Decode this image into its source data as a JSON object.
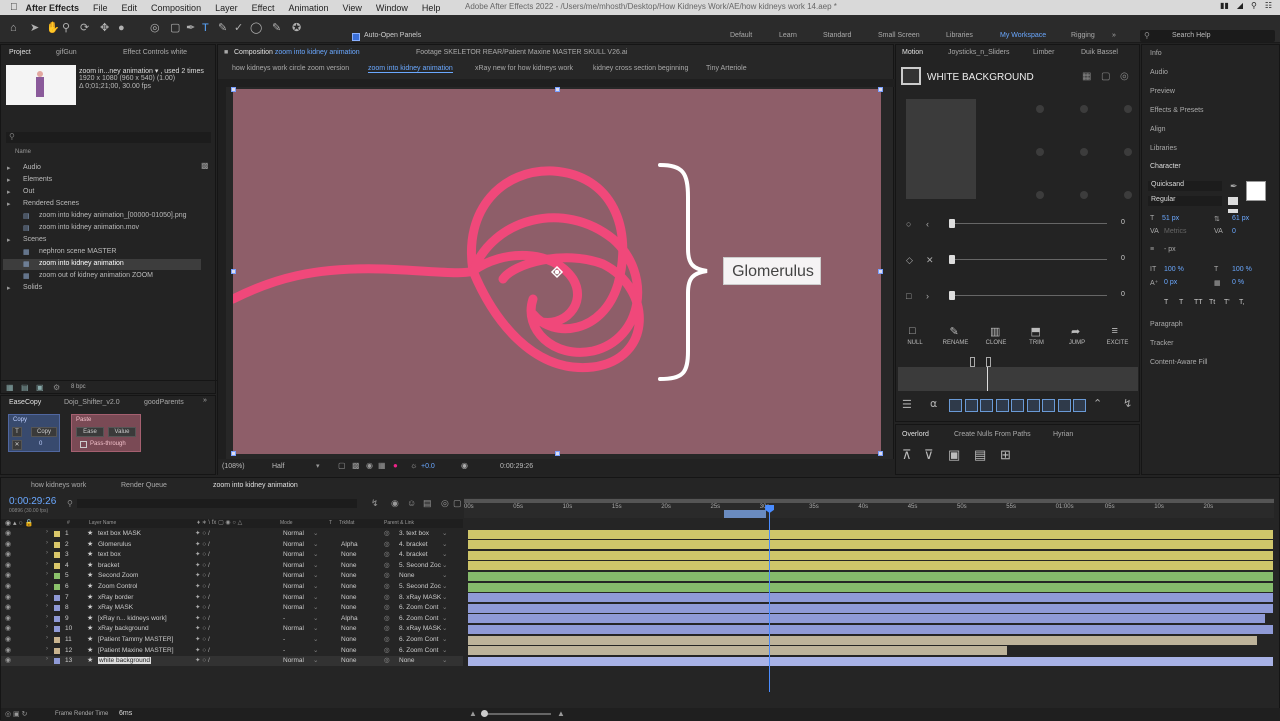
{
  "menubar": {
    "app": "After Effects",
    "items": [
      "File",
      "Edit",
      "Composition",
      "Layer",
      "Effect",
      "Animation",
      "View",
      "Window",
      "Help"
    ],
    "title": "Adobe After Effects 2022 - /Users/me/mhosth/Desktop/How Kidneys Work/AE/how kidneys work 14.aep *",
    "search": "Search Help"
  },
  "toolbar": {
    "auto_open": "Auto-Open Panels",
    "workspaces": [
      "Default",
      "Learn",
      "Standard",
      "Small Screen",
      "Libraries",
      "My Workspace",
      "Rigging"
    ],
    "active_ws": "My Workspace"
  },
  "project": {
    "tabs": [
      "Project",
      "gifGun",
      "Effect Controls white"
    ],
    "thumb_name": "zoom in...ney animation ▾ , used 2 times",
    "thumb_size": "1920 x 1080  (960 x 540) (1.00)",
    "thumb_dur": "Δ 0;01;21;00, 30.00 fps",
    "col_name": "Name",
    "tree": [
      {
        "label": "Audio",
        "indent": 0,
        "kind": "folder"
      },
      {
        "label": "Elements",
        "indent": 0,
        "kind": "folder"
      },
      {
        "label": "Out",
        "indent": 0,
        "kind": "folder"
      },
      {
        "label": "Rendered Scenes",
        "indent": 0,
        "kind": "folder"
      },
      {
        "label": "zoom into kidney animation_[00000-01050].png",
        "indent": 1,
        "kind": "file"
      },
      {
        "label": "zoom into kidney animation.mov",
        "indent": 1,
        "kind": "file"
      },
      {
        "label": "Scenes",
        "indent": 0,
        "kind": "folder"
      },
      {
        "label": "nephron scene MASTER",
        "indent": 1,
        "kind": "comp"
      },
      {
        "label": "zoom into kidney animation",
        "indent": 1,
        "kind": "comp"
      },
      {
        "label": "zoom out of kidney animation ZOOM",
        "indent": 1,
        "kind": "comp"
      },
      {
        "label": "Solids",
        "indent": 0,
        "kind": "folder"
      }
    ],
    "bpc": "8 bpc"
  },
  "easecopy": {
    "tabs": [
      "EaseCopy",
      "Dojo_Shifter_v2.0",
      "goodParents"
    ],
    "copy_title": "Copy",
    "copy_btn": "Copy",
    "copy_val": "0",
    "paste_title": "Paste",
    "ease_btn": "Ease",
    "value_btn": "Value",
    "passthrough": "Pass-through"
  },
  "viewer": {
    "tabs": [
      "Composition zoom into kidney animation",
      "Footage SKELETOR REAR/Patient Maxine MASTER SKULL V26.ai"
    ],
    "comp_prefix": "Composition",
    "comp_name": "zoom into kidney animation",
    "crumbs": [
      "how kidneys work circle zoom version",
      "zoom into kidney animation",
      "xRay new for how kidneys work",
      "kidney cross section beginning",
      "Tiny Arteriole"
    ],
    "label": "Glomerulus",
    "zoom": "(108%)",
    "res": "Half",
    "exposure": "+0.0",
    "timecode": "0:00:29:26",
    "canvas_color": "#8e5e69",
    "stroke_color": "#f0487a"
  },
  "motion": {
    "tabs": [
      "Motion",
      "Joysticks_n_Sliders",
      "Limber",
      "Duik Bassel"
    ],
    "layer": "WHITE BACKGROUND",
    "slider_vals": [
      "0",
      "0",
      "0"
    ],
    "buttons": [
      "NULL",
      "RENAME",
      "CLONE",
      "TRIM",
      "JUMP",
      "EXCITE"
    ]
  },
  "overlord": {
    "tabs": [
      "Overlord",
      "Create Nulls From Paths",
      "Hyrian"
    ]
  },
  "right": {
    "items": [
      "Info",
      "Audio",
      "Preview",
      "Effects & Presets",
      "Align",
      "Libraries"
    ],
    "character": "Character",
    "font": "Quicksand",
    "style": "Regular",
    "size": "51 px",
    "leading": "61 px",
    "tracking": "0",
    "kerning_label": "Metrics",
    "stroke": "- px",
    "vscale": "100 %",
    "hscale": "100 %",
    "baseline": "0 px",
    "tsume": "0 %",
    "styles": [
      "T",
      "T",
      "TT",
      "Tt",
      "T'",
      "T,"
    ],
    "bottom": [
      "Paragraph",
      "Tracker",
      "Content-Aware Fill"
    ]
  },
  "timeline": {
    "tabs": [
      "how kidneys work",
      "Render Queue",
      "zoom into kidney animation"
    ],
    "time": "0:00:29:26",
    "frames": "00896 (30.00 fps)",
    "cols": {
      "name": "Layer Name",
      "mode": "Mode",
      "t": "T",
      "trkmat": "TrkMat",
      "parent": "Parent & Link"
    },
    "ruler": [
      "00s",
      "05s",
      "10s",
      "15s",
      "20s",
      "25s",
      "30s",
      "35s",
      "40s",
      "45s",
      "50s",
      "55s",
      "01:00s",
      "05s",
      "10s",
      "20s"
    ],
    "layers": [
      {
        "num": "1",
        "name": "text box MASK",
        "color": "#d9c76a",
        "mode": "Normal",
        "trk": "",
        "parent": "3. text box",
        "bar": "#cfc66a",
        "start": 0,
        "end": 1
      },
      {
        "num": "2",
        "name": "Glomerulus",
        "color": "#d9c76a",
        "mode": "Normal",
        "trk": "Alpha",
        "parent": "4. bracket",
        "bar": "#cfc66a",
        "start": 0,
        "end": 1
      },
      {
        "num": "3",
        "name": "text box",
        "color": "#d9c76a",
        "mode": "Normal",
        "trk": "None",
        "parent": "4. bracket",
        "bar": "#cfc66a",
        "start": 0,
        "end": 1
      },
      {
        "num": "4",
        "name": "bracket",
        "color": "#d9c76a",
        "mode": "Normal",
        "trk": "None",
        "parent": "5. Second Zoc",
        "bar": "#cfc66a",
        "start": 0,
        "end": 1
      },
      {
        "num": "5",
        "name": "Second Zoom",
        "color": "#8bc26b",
        "mode": "Normal",
        "trk": "None",
        "parent": "None",
        "bar": "#86ba6c",
        "start": 0,
        "end": 1
      },
      {
        "num": "6",
        "name": "Zoom Control",
        "color": "#8bc26b",
        "mode": "Normal",
        "trk": "None",
        "parent": "5. Second Zoc",
        "bar": "#86ba6c",
        "start": 0,
        "end": 1
      },
      {
        "num": "7",
        "name": "xRay border",
        "color": "#8f9ad6",
        "mode": "Normal",
        "trk": "None",
        "parent": "8. xRay MASK",
        "bar": "#8f9ad6",
        "start": 0,
        "end": 1
      },
      {
        "num": "8",
        "name": "xRay MASK",
        "color": "#8f9ad6",
        "mode": "Normal",
        "trk": "None",
        "parent": "6. Zoom Cont",
        "bar": "#8f9ad6",
        "start": 0,
        "end": 1
      },
      {
        "num": "9",
        "name": "[xRay n... kidneys work]",
        "color": "#8f9ad6",
        "mode": "-",
        "trk": "Alpha",
        "parent": "6. Zoom Cont",
        "bar": "#8f9ad6",
        "start": 0,
        "end": 0.99
      },
      {
        "num": "10",
        "name": "xRay background",
        "color": "#8f9ad6",
        "mode": "Normal",
        "trk": "None",
        "parent": "8. xRay MASK",
        "bar": "#8f9ad6",
        "start": 0,
        "end": 1
      },
      {
        "num": "11",
        "name": "[Patient Tammy MASTER]",
        "color": "#c9b48f",
        "mode": "-",
        "trk": "None",
        "parent": "6. Zoom Cont",
        "bar": "#bdb39a",
        "start": 0,
        "end": 0.98
      },
      {
        "num": "12",
        "name": "[Patient Maxine MASTER]",
        "color": "#c9b48f",
        "mode": "-",
        "trk": "None",
        "parent": "6. Zoom Cont",
        "bar": "#bdb39a",
        "start": 0,
        "end": 0.67
      },
      {
        "num": "13",
        "name": "white background",
        "color": "#8f9ad6",
        "mode": "Normal",
        "trk": "None",
        "parent": "None",
        "bar": "#a8b2e6",
        "start": 0,
        "end": 1
      }
    ],
    "playhead_frac": 0.379,
    "render_time_label": "Frame Render Time",
    "render_time": "6ms"
  }
}
